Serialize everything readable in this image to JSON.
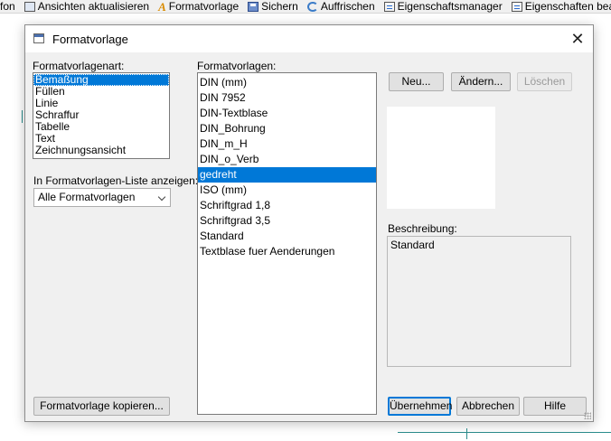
{
  "toolbar": {
    "items": [
      {
        "label": "fon",
        "icon": "none"
      },
      {
        "label": "Ansichten aktualisieren",
        "icon": "refresh-views-icon"
      },
      {
        "label": "Formatvorlage",
        "icon": "format-style-icon"
      },
      {
        "label": "Sichern",
        "icon": "save-icon"
      },
      {
        "label": "Auffrischen",
        "icon": "refresh-icon"
      },
      {
        "label": "Eigenschaftsmanager",
        "icon": "property-manager-icon"
      },
      {
        "label": "Eigenschaften bearbeiten",
        "icon": "edit-properties-icon"
      }
    ]
  },
  "dialog": {
    "title": "Formatvorlage",
    "close_glyph": "✕",
    "type_label": "Formatvorlagenart:",
    "types": [
      "Bemaßung",
      "Füllen",
      "Linie",
      "Schraffur",
      "Tabelle",
      "Text",
      "Zeichnungsansicht"
    ],
    "selected_type_index": 0,
    "styles_label": "Formatvorlagen:",
    "styles": [
      "DIN (mm)",
      "DIN 7952",
      "DIN-Textblase",
      "DIN_Bohrung",
      "DIN_m_H",
      "DIN_o_Verb",
      "gedreht",
      "ISO (mm)",
      "Schriftgrad 1,8",
      "Schriftgrad 3,5",
      "Standard",
      "Textblase fuer Aenderungen"
    ],
    "selected_style_index": 6,
    "show_label": "In Formatvorlagen-Liste anzeigen:",
    "show_value": "Alle Formatvorlagen",
    "new_button": "Neu...",
    "change_button": "Ändern...",
    "delete_button": "Löschen",
    "description_label": "Beschreibung:",
    "description_text": "Standard",
    "copy_button": "Formatvorlage kopieren...",
    "apply_button": "Übernehmen",
    "cancel_button": "Abbrechen",
    "help_button": "Hilfe"
  },
  "colors": {
    "selection": "#0078d7",
    "dialog_bg": "#f0f0f0",
    "accent_line": "#2a8c8c"
  }
}
